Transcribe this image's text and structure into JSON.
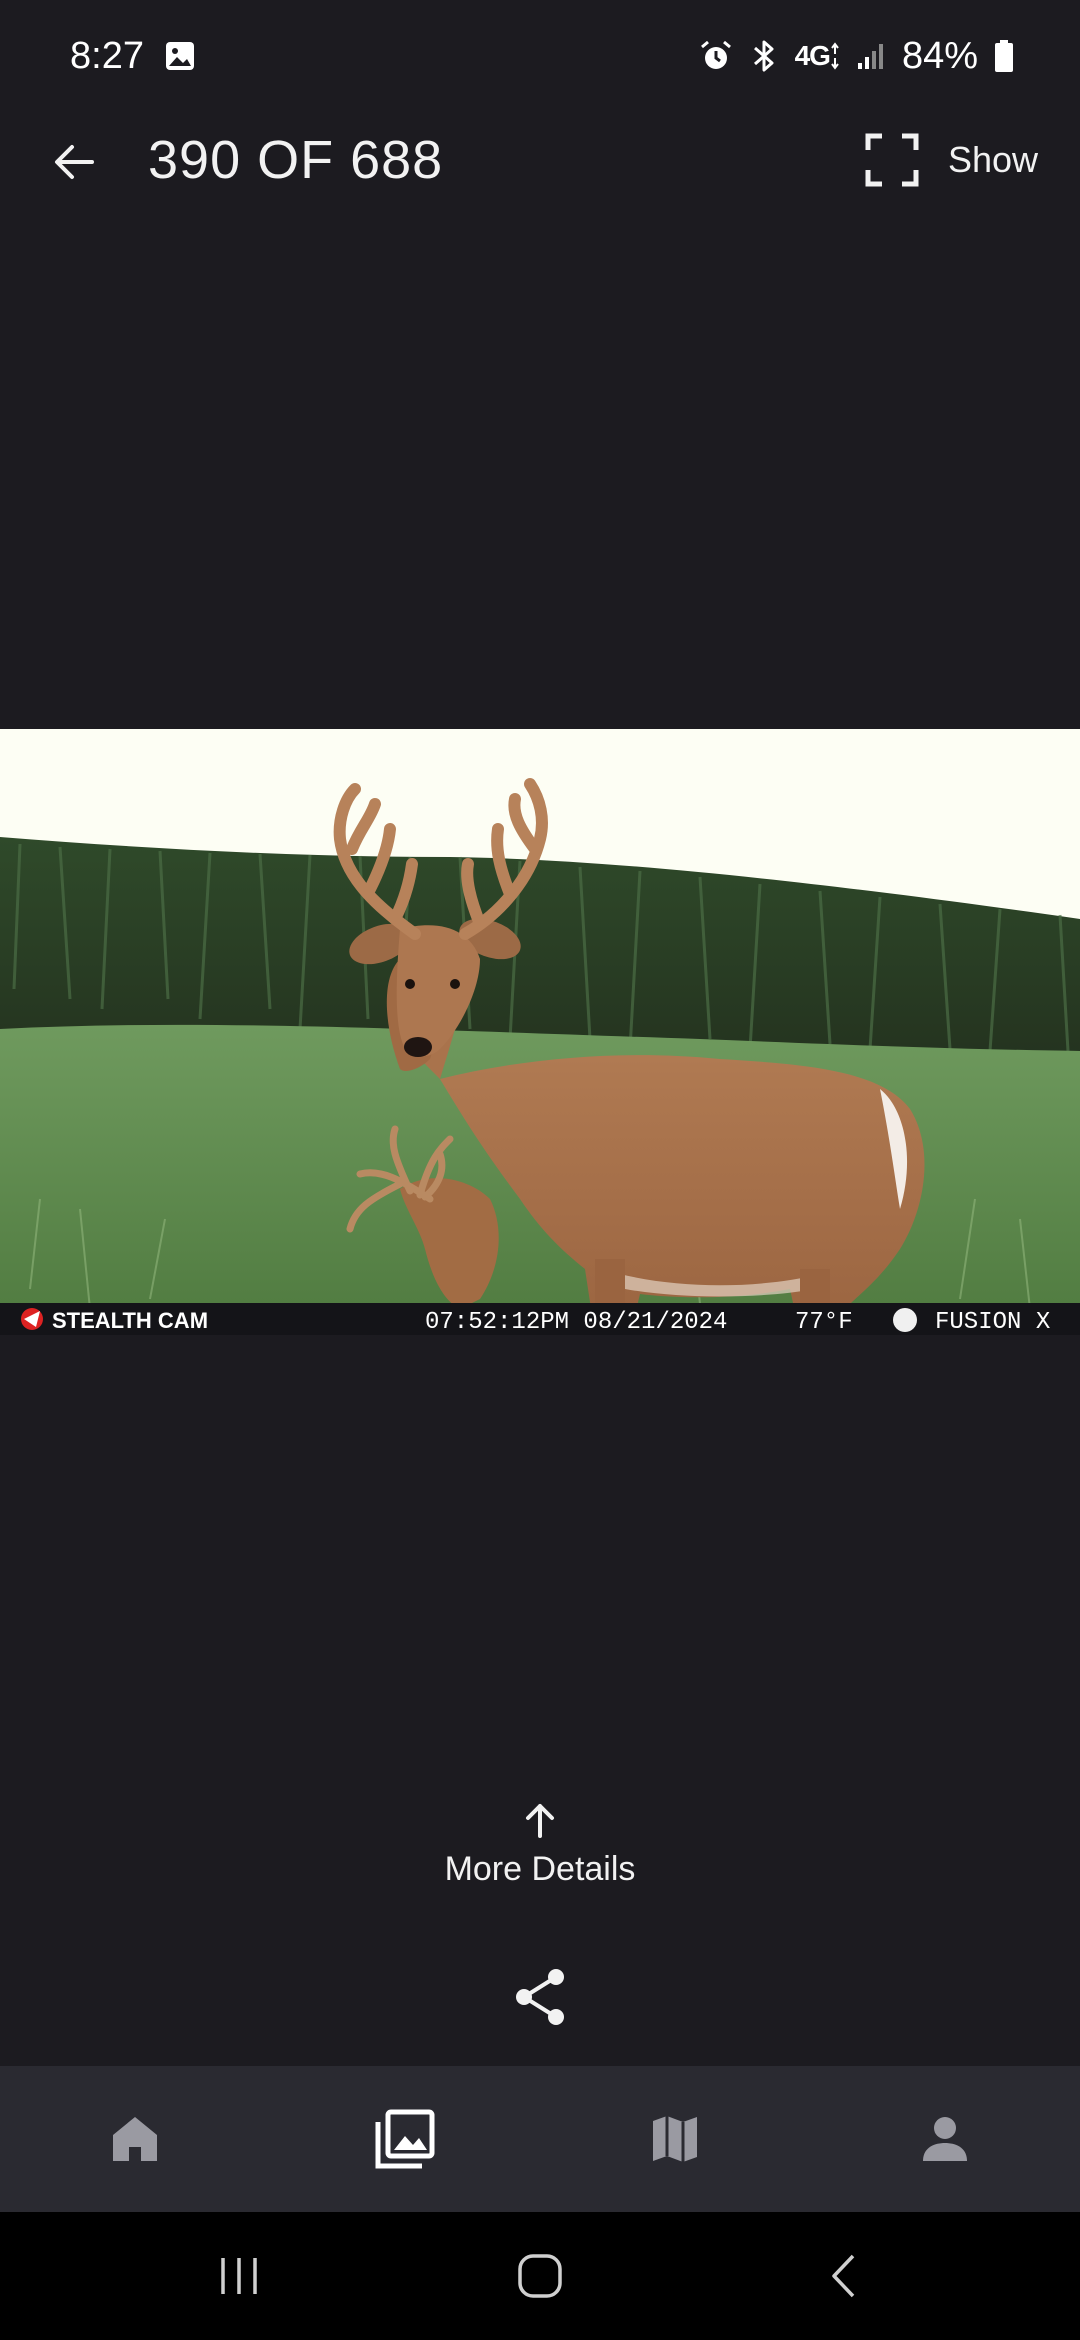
{
  "status_bar": {
    "time": "8:27",
    "network": "4G",
    "battery_percent": "84%",
    "icons": [
      "image-icon",
      "alarm-icon",
      "bluetooth-icon",
      "lte-icon",
      "signal-icon",
      "battery-icon"
    ]
  },
  "header": {
    "counter": "390 OF 688",
    "show_label": "Show",
    "back_icon": "arrow-left-icon",
    "fullscreen_icon": "fullscreen-icon"
  },
  "photo": {
    "subject": "trail camera photo",
    "overlay": {
      "brand": "STEALTH CAM",
      "timestamp": "07:52:12PM 08/21/2024",
      "temperature": "77°F",
      "model": "FUSION X"
    }
  },
  "more_details": {
    "label": "More Details",
    "icon": "arrow-up-icon"
  },
  "share": {
    "icon": "share-icon"
  },
  "bottom_nav": {
    "items": [
      {
        "name": "home",
        "icon": "home-icon",
        "active": false
      },
      {
        "name": "gallery",
        "icon": "gallery-icon",
        "active": true
      },
      {
        "name": "map",
        "icon": "map-icon",
        "active": false
      },
      {
        "name": "profile",
        "icon": "person-icon",
        "active": false
      }
    ],
    "active_color": "#ffffff",
    "inactive_color": "#9a9aa2"
  },
  "system_nav": {
    "icons": [
      "recents-icon",
      "home-circle-icon",
      "back-chevron-icon"
    ]
  },
  "colors": {
    "background": "#1c1b20",
    "nav_background": "#2a2a31",
    "system_nav": "#000000"
  }
}
